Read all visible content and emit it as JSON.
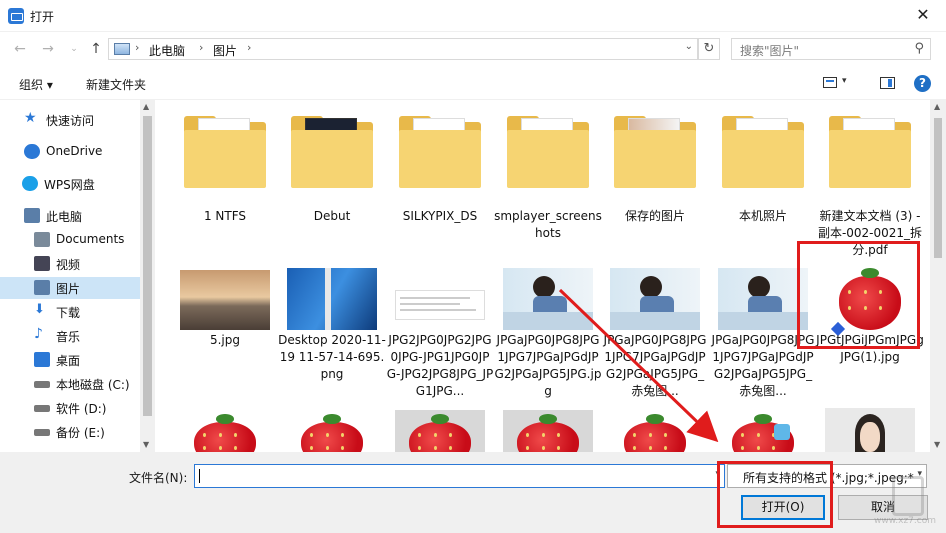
{
  "window": {
    "title": "打开",
    "close_glyph": "✕"
  },
  "address": {
    "crumbs": [
      "此电脑",
      "图片"
    ],
    "search_placeholder": "搜索\"图片\""
  },
  "toolbar": {
    "organize": "组织 ▾",
    "new_folder": "新建文件夹",
    "help": "?"
  },
  "sidebar": {
    "items": [
      {
        "label": "快速访问",
        "icon": "star-icon"
      },
      {
        "label": "OneDrive",
        "icon": "cloud-icon"
      },
      {
        "label": "WPS网盘",
        "icon": "cloud-icon"
      },
      {
        "label": "此电脑",
        "icon": "computer-icon"
      },
      {
        "label": "Documents",
        "icon": "document-icon"
      },
      {
        "label": "视频",
        "icon": "video-icon"
      },
      {
        "label": "图片",
        "icon": "picture-icon",
        "selected": true
      },
      {
        "label": "下载",
        "icon": "download-icon"
      },
      {
        "label": "音乐",
        "icon": "music-icon"
      },
      {
        "label": "桌面",
        "icon": "desktop-icon"
      },
      {
        "label": "本地磁盘 (C:)",
        "icon": "drive-icon"
      },
      {
        "label": "软件 (D:)",
        "icon": "drive-icon"
      },
      {
        "label": "备份 (E:)",
        "icon": "drive-icon"
      }
    ]
  },
  "files": {
    "row1": [
      {
        "name": "1 NTFS",
        "kind": "folder"
      },
      {
        "name": "Debut",
        "kind": "folder"
      },
      {
        "name": "SILKYPIX_DS",
        "kind": "folder"
      },
      {
        "name": "smplayer_screenshots",
        "kind": "folder"
      },
      {
        "name": "保存的图片",
        "kind": "folder"
      },
      {
        "name": "本机照片",
        "kind": "folder"
      },
      {
        "name": "新建文本文档 (3) - 副本-002-0021_拆分.pdf",
        "kind": "folder"
      }
    ],
    "row2": [
      {
        "name": "5.jpg",
        "kind": "photo"
      },
      {
        "name": "Desktop 2020-11-19 11-57-14-695.png",
        "kind": "photo"
      },
      {
        "name": "JPG2JPG0JPG2JPG0JPG-JPG1JPG0JPG-JPG2JPG8JPG_JPG1JPG...",
        "kind": "photo"
      },
      {
        "name": "JPGaJPG0JPG8JPG1JPG7JPGaJPGdJPG2JPGaJPG5JPG.jpg",
        "kind": "photo"
      },
      {
        "name": "JPGaJPG0JPG8JPG1JPG7JPGaJPGdJPG2JPGaJPG5JPG_赤兔图...",
        "kind": "photo"
      },
      {
        "name": "JPGaJPG0JPG8JPG1JPG7JPGaJPGdJPG2JPGaJPG5JPG_赤兔图...",
        "kind": "photo"
      },
      {
        "name": "JPGtJPGiJPGmJPGgJPG(1).jpg",
        "kind": "photo"
      }
    ]
  },
  "bottom": {
    "filename_label": "文件名(N):",
    "filename_value": "",
    "filter_value": "所有支持的格式 (*.jpg;*.jpeg;*",
    "open_button": "打开(O)",
    "cancel_button": "取消"
  },
  "watermark_text": "www.xz7.com",
  "colors": {
    "accent": "#0078d7",
    "selection": "#cce4f7",
    "highlight": "#e01c1c"
  }
}
